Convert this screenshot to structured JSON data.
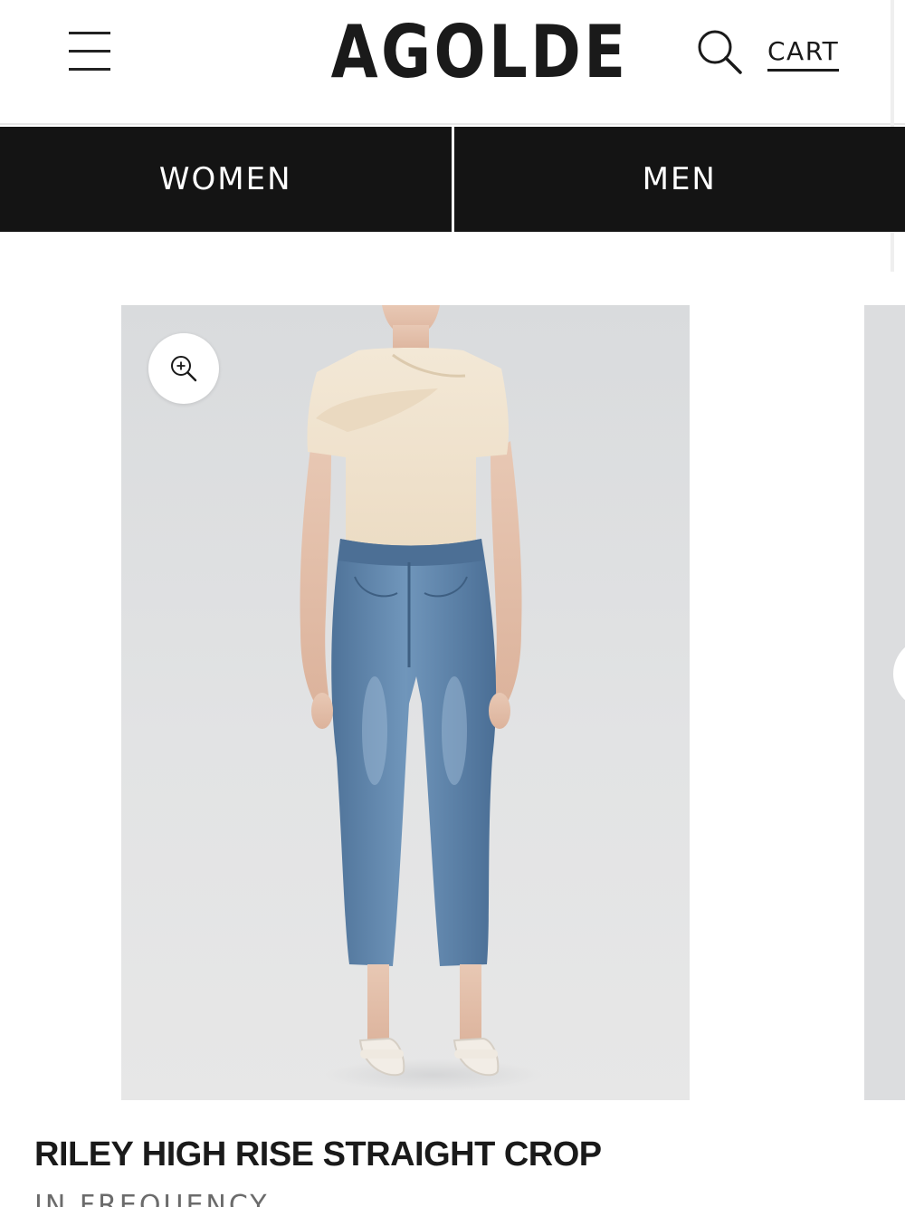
{
  "header": {
    "logo": "AGOLDE",
    "cart_label": "CART",
    "menu_icon": "hamburger-menu-icon",
    "search_icon": "search-icon"
  },
  "tabs": [
    {
      "label": "WOMEN"
    },
    {
      "label": "MEN"
    }
  ],
  "product": {
    "zoom_icon": "zoom-in-icon",
    "title": "RILEY HIGH RISE STRAIGHT CROP",
    "subtitle": "IN FREQUENCY"
  },
  "colors": {
    "tab_background": "#141414",
    "image_background": "#dedfe0",
    "denim": "#5b7ea4"
  }
}
